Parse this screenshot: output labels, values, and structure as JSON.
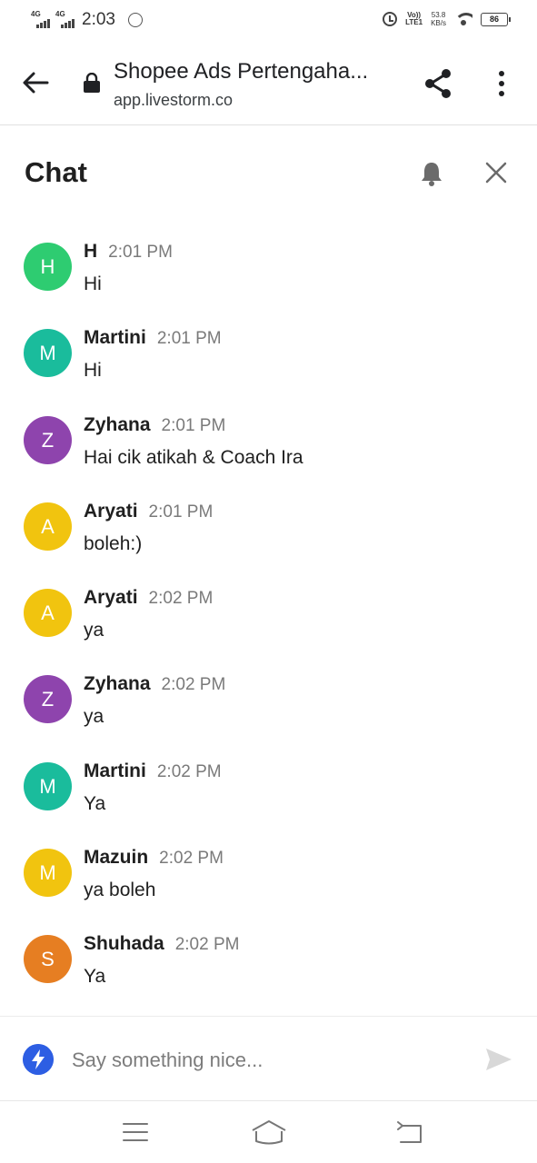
{
  "status_bar": {
    "signal1_label": "4G",
    "signal2_label": "4G",
    "time": "2:03",
    "volte_line1": "Vo))",
    "volte_line2": "LTE1",
    "speed_value": "53.8",
    "speed_unit": "KB/s",
    "battery": "86"
  },
  "browser": {
    "title": "Shopee Ads Pertengaha...",
    "url": "app.livestorm.co"
  },
  "chat": {
    "title": "Chat",
    "messages": [
      {
        "author": "H",
        "time": "2:01 PM",
        "text": "Hi",
        "initial": "H"
      },
      {
        "author": "Martini",
        "time": "2:01 PM",
        "text": "Hi",
        "initial": "M"
      },
      {
        "author": "Zyhana",
        "time": "2:01 PM",
        "text": "Hai cik atikah & Coach Ira",
        "initial": "Z"
      },
      {
        "author": "Aryati",
        "time": "2:01 PM",
        "text": "boleh:)",
        "initial": "A"
      },
      {
        "author": "Aryati",
        "time": "2:02 PM",
        "text": "ya",
        "initial": "A"
      },
      {
        "author": "Zyhana",
        "time": "2:02 PM",
        "text": "ya",
        "initial": "Z"
      },
      {
        "author": "Martini",
        "time": "2:02 PM",
        "text": "Ya",
        "initial": "M"
      },
      {
        "author": "Mazuin",
        "time": "2:02 PM",
        "text": "ya boleh",
        "initial": "M"
      },
      {
        "author": "Shuhada",
        "time": "2:02 PM",
        "text": "Ya",
        "initial": "S"
      }
    ]
  },
  "composer": {
    "placeholder": "Say something nice..."
  },
  "colors": {
    "avatar_green": "#2ecc71",
    "avatar_teal": "#1abc9c",
    "avatar_purple": "#8e44ad",
    "avatar_yellow": "#f1c40f",
    "avatar_orange": "#e67e22",
    "accent_blue": "#2d5ee3"
  }
}
